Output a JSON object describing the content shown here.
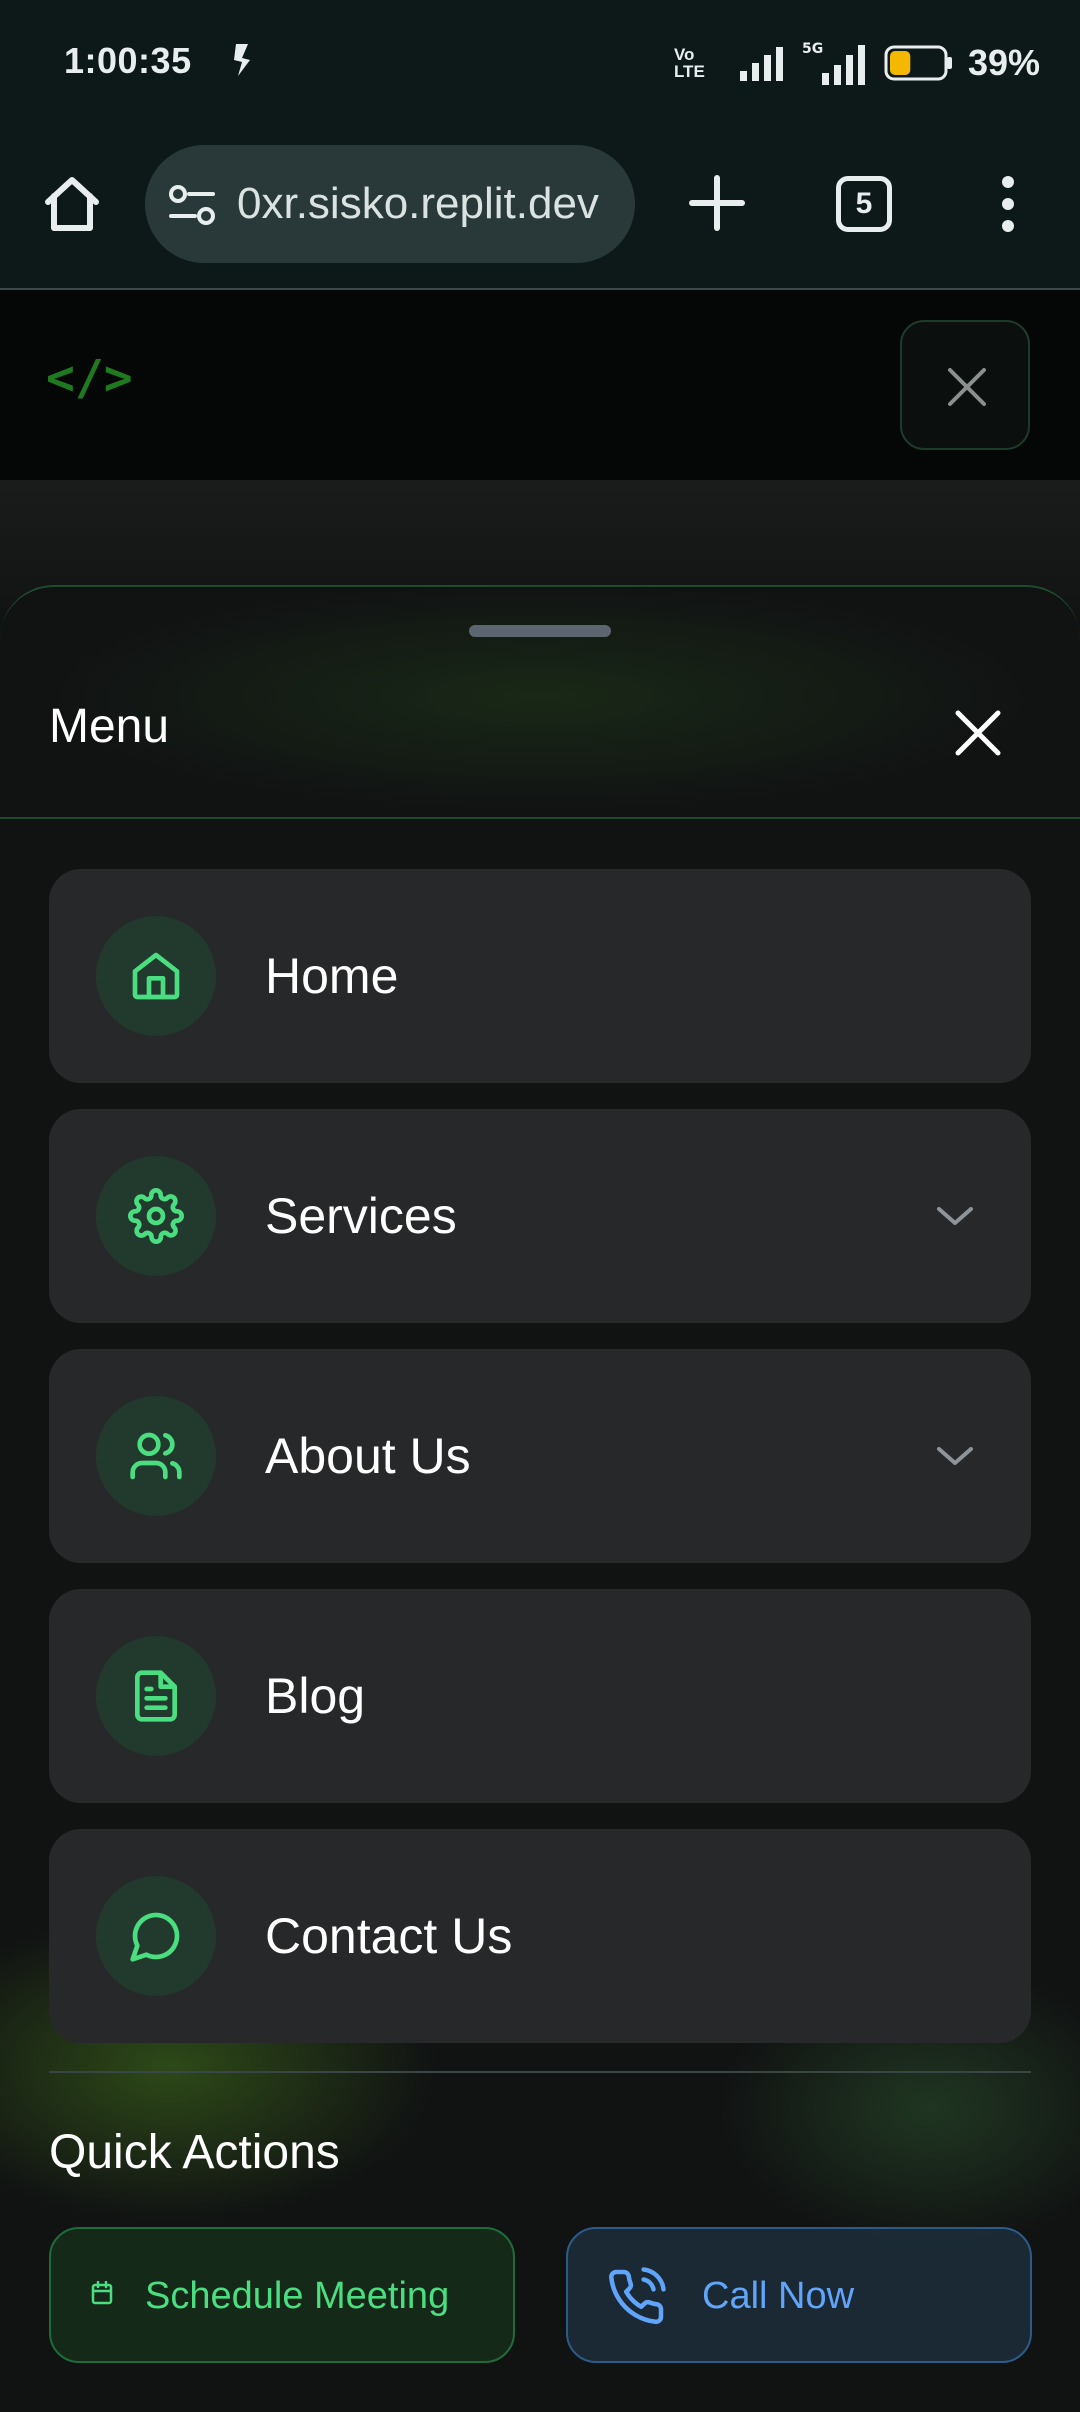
{
  "status_bar": {
    "time": "1:00:35",
    "network_label": "Vo LTE",
    "network_type": "5G",
    "battery_percent": "39%",
    "battery_level": 0.39
  },
  "browser": {
    "url": "0xr.sisko.replit.dev",
    "tab_count": "5",
    "icons": [
      "home-icon",
      "tune-icon",
      "plus-icon",
      "tabs-icon",
      "more-vert-icon"
    ]
  },
  "site": {
    "logo_text": "</>"
  },
  "menu": {
    "title": "Menu",
    "items": [
      {
        "label": "Home",
        "icon": "home-icon",
        "expandable": false
      },
      {
        "label": "Services",
        "icon": "gear-icon",
        "expandable": true
      },
      {
        "label": "About Us",
        "icon": "users-icon",
        "expandable": true
      },
      {
        "label": "Blog",
        "icon": "document-icon",
        "expandable": false
      },
      {
        "label": "Contact Us",
        "icon": "chat-bubble-icon",
        "expandable": false
      }
    ]
  },
  "quick_actions": {
    "title": "Quick Actions",
    "schedule_label": "Schedule Meeting",
    "call_label": "Call Now"
  },
  "colors": {
    "accent_green": "#4ade80",
    "accent_blue": "#60a5fa",
    "card_bg": "#27282a",
    "battery_fill": "#f5b800"
  }
}
